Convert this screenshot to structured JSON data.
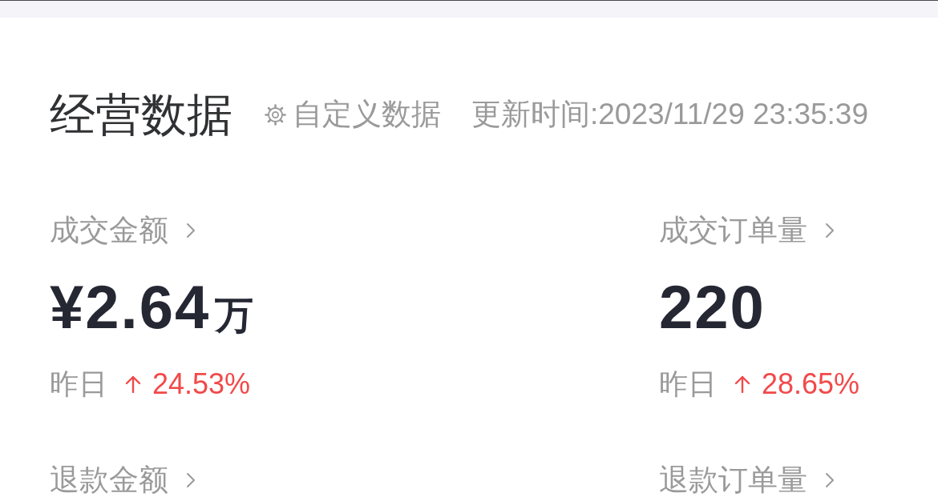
{
  "header": {
    "title": "经营数据",
    "customize_link": "自定义数据",
    "updated_at": "更新时间:2023/11/29 23:35:39"
  },
  "metrics": [
    {
      "label": "成交金额",
      "value": "¥2.64",
      "unit": "万",
      "compare_label": "昨日",
      "change": "24.53%"
    },
    {
      "label": "成交订单量",
      "value": "220",
      "compare_label": "昨日",
      "change": "28.65%"
    },
    {
      "label": "退款金额"
    },
    {
      "label": "退款订单量"
    }
  ]
}
